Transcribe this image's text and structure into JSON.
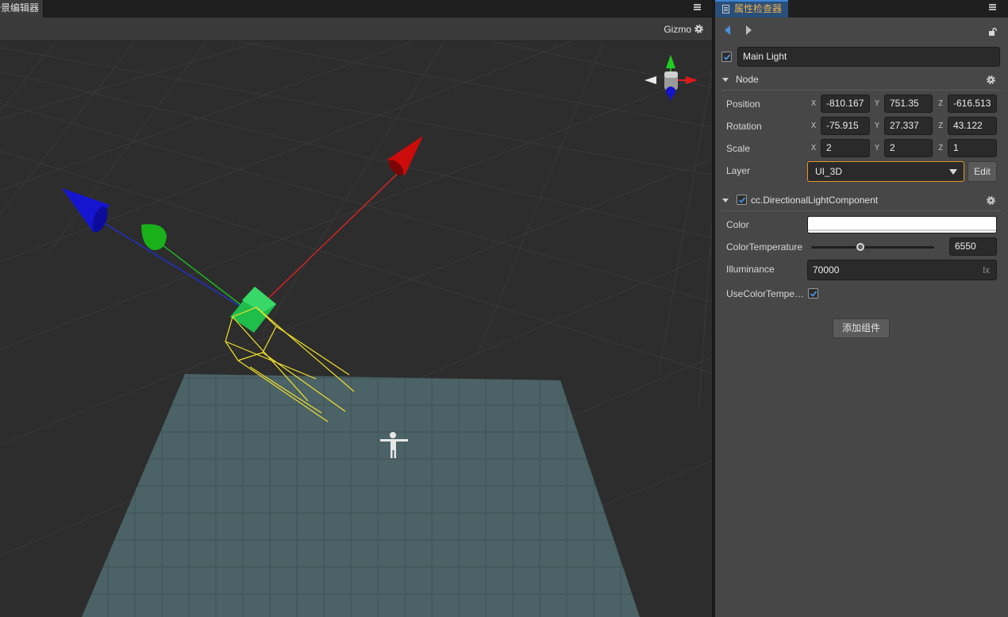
{
  "scene": {
    "tab_title": "场景编辑器",
    "gizmo_label": "Gizmo"
  },
  "inspector": {
    "tab_title": "属性检查器",
    "node_name": "Main Light",
    "node_enabled": true,
    "node_section": {
      "title": "Node",
      "position": {
        "label": "Position",
        "x": "-810.167",
        "y": "751.35",
        "z": "-616.513"
      },
      "rotation": {
        "label": "Rotation",
        "x": "-75.915",
        "y": "27.337",
        "z": "43.122"
      },
      "scale": {
        "label": "Scale",
        "x": "2",
        "y": "2",
        "z": "1"
      },
      "layer": {
        "label": "Layer",
        "value": "UI_3D",
        "edit_label": "Edit"
      }
    },
    "axis_labels": {
      "x": "X",
      "y": "Y",
      "z": "Z"
    },
    "component": {
      "title": "cc.DirectionalLightComponent",
      "enabled": true,
      "color_label": "Color",
      "color_value": "#ffffff",
      "color_temperature_label": "ColorTemperature",
      "color_temperature_value": "6550",
      "color_temperature_fraction": 0.4,
      "illuminance_label": "Illuminance",
      "illuminance_value": "70000",
      "illuminance_unit": "lx",
      "use_color_temperature_label": "UseColorTempe…",
      "use_color_temperature_checked": true
    },
    "add_component_label": "添加组件"
  }
}
